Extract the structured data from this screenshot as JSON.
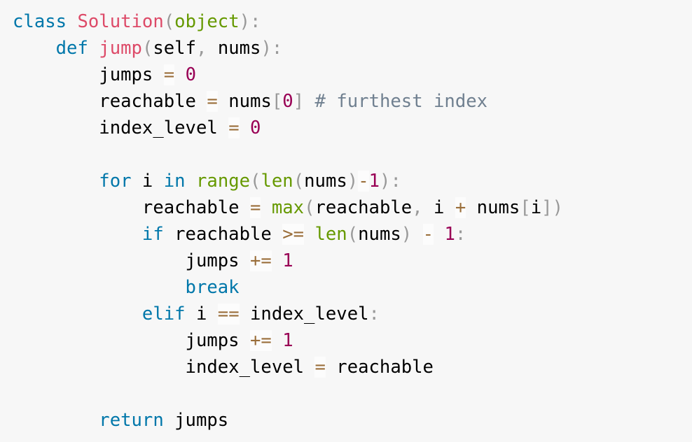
{
  "colors": {
    "background": "#f7f7f7",
    "keyword": "#0077aa",
    "class_name": "#dd4a68",
    "function": "#dd4a68",
    "builtin": "#669900",
    "number": "#990055",
    "operator": "#9a6e3a",
    "punctuation": "#999999",
    "comment": "#708090"
  },
  "code": {
    "lines": [
      {
        "indent": "",
        "tokens": [
          [
            "keyword",
            "class"
          ],
          [
            "plain",
            " "
          ],
          [
            "class-name",
            "Solution"
          ],
          [
            "punctuation",
            "("
          ],
          [
            "builtin",
            "object"
          ],
          [
            "punctuation",
            ")"
          ],
          [
            "punctuation",
            ":"
          ]
        ]
      },
      {
        "indent": "    ",
        "tokens": [
          [
            "keyword",
            "def"
          ],
          [
            "plain",
            " "
          ],
          [
            "function",
            "jump"
          ],
          [
            "punctuation",
            "("
          ],
          [
            "plain",
            "self"
          ],
          [
            "punctuation",
            ","
          ],
          [
            "plain",
            " nums"
          ],
          [
            "punctuation",
            ")"
          ],
          [
            "punctuation",
            ":"
          ]
        ]
      },
      {
        "indent": "        ",
        "tokens": [
          [
            "plain",
            "jumps "
          ],
          [
            "operator",
            "="
          ],
          [
            "plain",
            " "
          ],
          [
            "number",
            "0"
          ]
        ]
      },
      {
        "indent": "        ",
        "tokens": [
          [
            "plain",
            "reachable "
          ],
          [
            "operator",
            "="
          ],
          [
            "plain",
            " nums"
          ],
          [
            "punctuation",
            "["
          ],
          [
            "number",
            "0"
          ],
          [
            "punctuation",
            "]"
          ],
          [
            "plain",
            " "
          ],
          [
            "comment",
            "# furthest index"
          ]
        ]
      },
      {
        "indent": "        ",
        "tokens": [
          [
            "plain",
            "index_level "
          ],
          [
            "operator",
            "="
          ],
          [
            "plain",
            " "
          ],
          [
            "number",
            "0"
          ]
        ]
      },
      {
        "indent": "",
        "tokens": []
      },
      {
        "indent": "        ",
        "tokens": [
          [
            "keyword",
            "for"
          ],
          [
            "plain",
            " i "
          ],
          [
            "keyword",
            "in"
          ],
          [
            "plain",
            " "
          ],
          [
            "builtin",
            "range"
          ],
          [
            "punctuation",
            "("
          ],
          [
            "builtin",
            "len"
          ],
          [
            "punctuation",
            "("
          ],
          [
            "plain",
            "nums"
          ],
          [
            "punctuation",
            ")"
          ],
          [
            "operator",
            "-"
          ],
          [
            "number",
            "1"
          ],
          [
            "punctuation",
            ")"
          ],
          [
            "punctuation",
            ":"
          ]
        ]
      },
      {
        "indent": "            ",
        "tokens": [
          [
            "plain",
            "reachable "
          ],
          [
            "operator",
            "="
          ],
          [
            "plain",
            " "
          ],
          [
            "builtin",
            "max"
          ],
          [
            "punctuation",
            "("
          ],
          [
            "plain",
            "reachable"
          ],
          [
            "punctuation",
            ","
          ],
          [
            "plain",
            " i "
          ],
          [
            "operator",
            "+"
          ],
          [
            "plain",
            " nums"
          ],
          [
            "punctuation",
            "["
          ],
          [
            "plain",
            "i"
          ],
          [
            "punctuation",
            "]"
          ],
          [
            "punctuation",
            ")"
          ]
        ]
      },
      {
        "indent": "            ",
        "tokens": [
          [
            "keyword",
            "if"
          ],
          [
            "plain",
            " reachable "
          ],
          [
            "operator",
            ">="
          ],
          [
            "plain",
            " "
          ],
          [
            "builtin",
            "len"
          ],
          [
            "punctuation",
            "("
          ],
          [
            "plain",
            "nums"
          ],
          [
            "punctuation",
            ")"
          ],
          [
            "plain",
            " "
          ],
          [
            "operator",
            "-"
          ],
          [
            "plain",
            " "
          ],
          [
            "number",
            "1"
          ],
          [
            "punctuation",
            ":"
          ]
        ]
      },
      {
        "indent": "                ",
        "tokens": [
          [
            "plain",
            "jumps "
          ],
          [
            "operator",
            "+="
          ],
          [
            "plain",
            " "
          ],
          [
            "number",
            "1"
          ]
        ]
      },
      {
        "indent": "                ",
        "tokens": [
          [
            "keyword",
            "break"
          ]
        ]
      },
      {
        "indent": "            ",
        "tokens": [
          [
            "keyword",
            "elif"
          ],
          [
            "plain",
            " i "
          ],
          [
            "operator",
            "=="
          ],
          [
            "plain",
            " index_level"
          ],
          [
            "punctuation",
            ":"
          ]
        ]
      },
      {
        "indent": "                ",
        "tokens": [
          [
            "plain",
            "jumps "
          ],
          [
            "operator",
            "+="
          ],
          [
            "plain",
            " "
          ],
          [
            "number",
            "1"
          ]
        ]
      },
      {
        "indent": "                ",
        "tokens": [
          [
            "plain",
            "index_level "
          ],
          [
            "operator",
            "="
          ],
          [
            "plain",
            " reachable"
          ]
        ]
      },
      {
        "indent": "",
        "tokens": []
      },
      {
        "indent": "        ",
        "tokens": [
          [
            "keyword",
            "return"
          ],
          [
            "plain",
            " jumps"
          ]
        ]
      }
    ]
  }
}
